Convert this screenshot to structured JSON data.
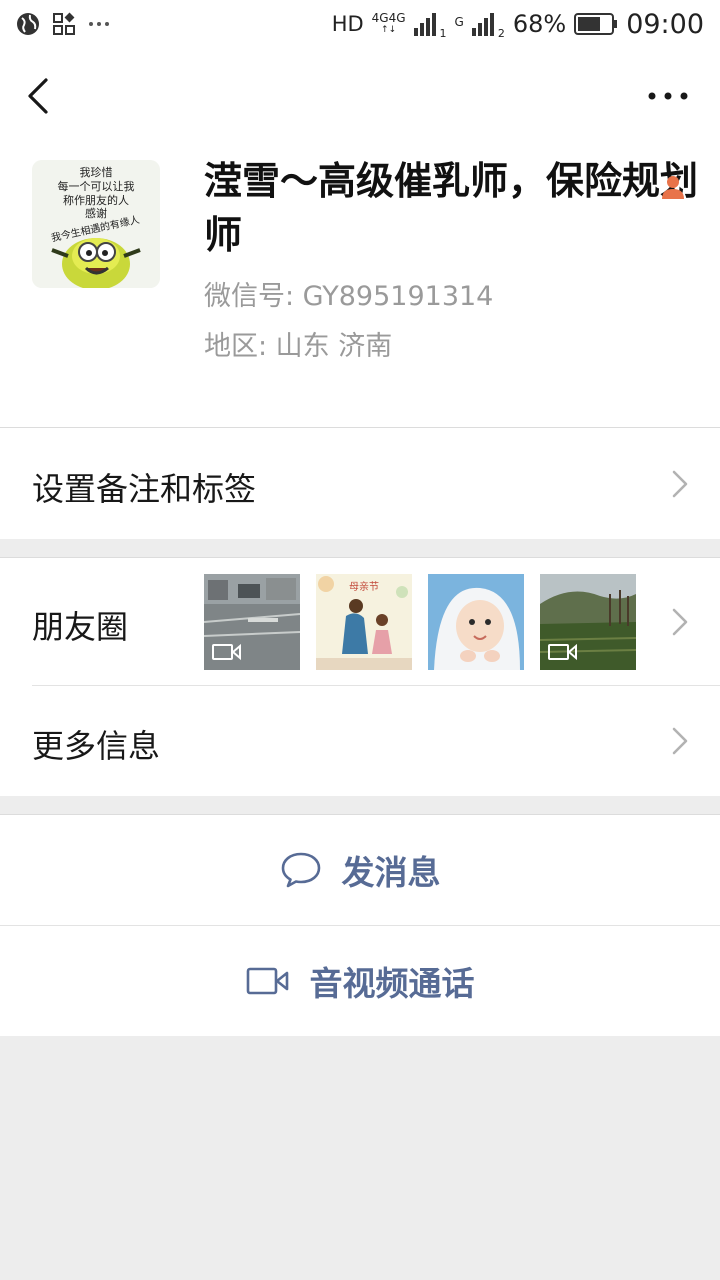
{
  "status_bar": {
    "network_label": "HD",
    "sim1_label": "4G",
    "sim1_label2": "4G",
    "sim1_index": "1",
    "sim2_label": "G",
    "sim2_index": "2",
    "battery_percent": "68%",
    "battery_level": 0.68,
    "time": "09:00"
  },
  "profile": {
    "name": "滢雪～高级催乳师，保险规划师",
    "wechat_id": "微信号:  GY895191314",
    "region": "地区:  山东  济南",
    "avatar_text_lines": [
      "我珍惜",
      "每一个可以让我",
      "称作朋友的人",
      "感谢",
      "我今生相遇的有缘人"
    ],
    "gender_icon_color": "#e8734a"
  },
  "rows": {
    "remark": "设置备注和标签",
    "moments": "朋友圈",
    "more_info": "更多信息"
  },
  "moments_thumbs": [
    {
      "name": "street-photo",
      "has_video": true
    },
    {
      "name": "mother-daughter-illustration",
      "has_video": false
    },
    {
      "name": "baby-photo",
      "has_video": false
    },
    {
      "name": "field-landscape",
      "has_video": true
    }
  ],
  "actions": {
    "send_message": "发消息",
    "video_call": "音视频通话"
  },
  "colors": {
    "accent_link": "#576b95",
    "background": "#ededed"
  }
}
